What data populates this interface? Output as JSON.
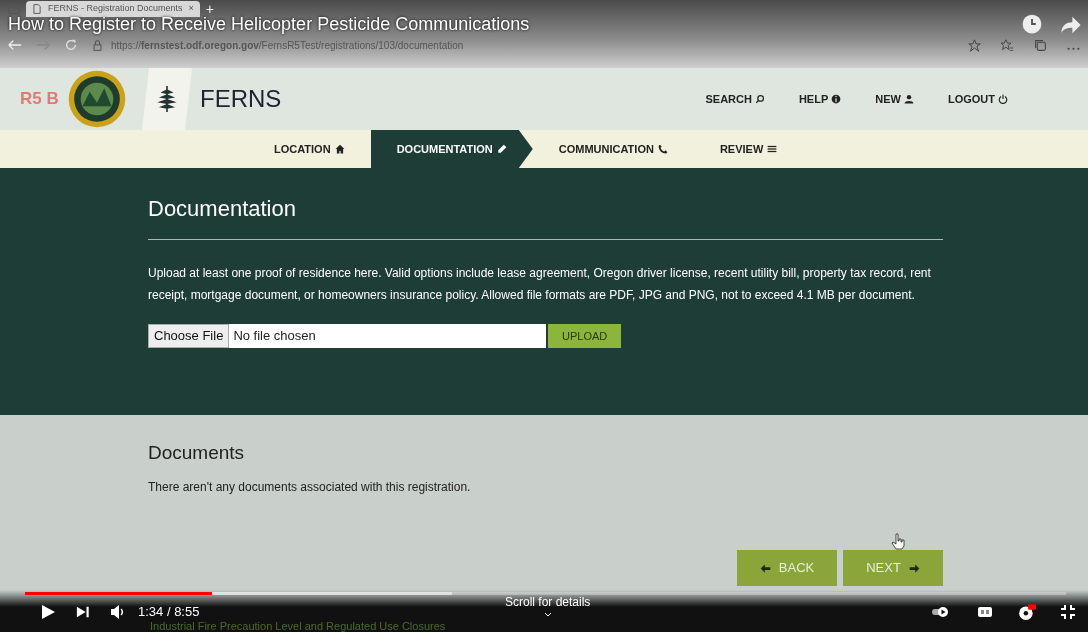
{
  "browser": {
    "tab_title": "FERNS - Registration Documents",
    "tab_close": "×",
    "new_tab": "+",
    "url": "https://**fernstest.odf.oregon.gov**/FernsR5Test/registrations/103/documentation"
  },
  "video": {
    "title": "How to Register to Receive Helicopter Pesticide Communications",
    "time": "1:34 / 8:55",
    "scroll_hint": "Scroll for details",
    "overlay_text": "Industrial Fire Precaution Level and Regulated Use Closures",
    "progress": {
      "level": 0.18
    },
    "buffered": {
      "level": 0.41
    }
  },
  "site": {
    "brand_fragment": "R5 B",
    "title": "FERNS",
    "nav": [
      {
        "label": "SEARCH"
      },
      {
        "label": "HELP"
      },
      {
        "label": "NEW"
      },
      {
        "label": "LOGOUT"
      }
    ],
    "steps": [
      {
        "label": "LOCATION",
        "selected": false
      },
      {
        "label": "DOCUMENTATION",
        "selected": true
      },
      {
        "label": "COMMUNICATION",
        "selected": false
      },
      {
        "label": "REVIEW",
        "selected": false
      }
    ]
  },
  "documentation": {
    "heading": "Documentation",
    "instructions": "Upload at least one proof of residence here. Valid options include lease agreement, Oregon driver license, recent utility bill, property tax record, rent receipt, mortgage document, or homeowners insurance policy. Allowed file formats are PDF, JPG and PNG, not to exceed 4.1 MB per document.",
    "file_button": "Choose File",
    "file_status": "No file chosen",
    "upload_button": "UPLOAD"
  },
  "documents": {
    "heading": "Documents",
    "empty_text": "There aren't any documents associated with this registration.",
    "buttons": [
      {
        "label": "BACK"
      },
      {
        "label": "NEXT"
      }
    ]
  }
}
